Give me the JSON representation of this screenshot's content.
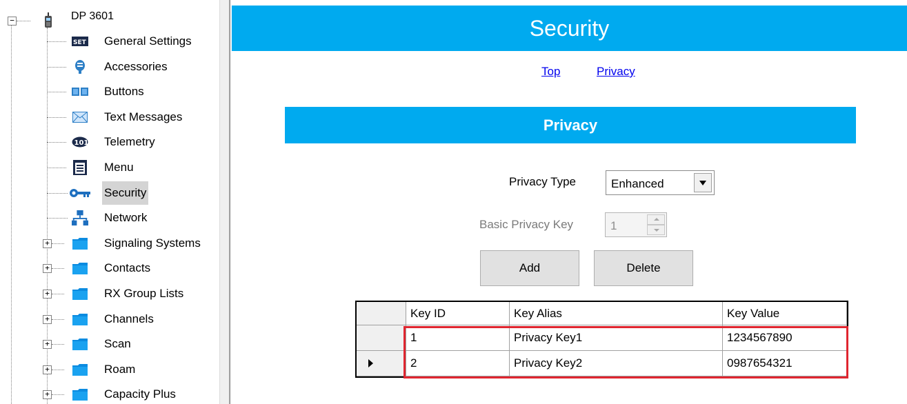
{
  "tree": {
    "root": {
      "label": "DP 3601",
      "icon": "radio-device-icon",
      "expander": "−"
    },
    "items": [
      {
        "label": "General Settings",
        "icon": "settings-icon"
      },
      {
        "label": "Accessories",
        "icon": "accessory-icon"
      },
      {
        "label": "Buttons",
        "icon": "buttons-icon"
      },
      {
        "label": "Text Messages",
        "icon": "envelope-icon"
      },
      {
        "label": "Telemetry",
        "icon": "telemetry-icon"
      },
      {
        "label": "Menu",
        "icon": "menu-icon"
      },
      {
        "label": "Security",
        "icon": "key-icon",
        "selected": true
      },
      {
        "label": "Network",
        "icon": "network-icon"
      },
      {
        "label": "Signaling Systems",
        "icon": "folder-icon",
        "expander": "+"
      },
      {
        "label": "Contacts",
        "icon": "folder-icon",
        "expander": "+"
      },
      {
        "label": "RX Group Lists",
        "icon": "folder-icon",
        "expander": "+"
      },
      {
        "label": "Channels",
        "icon": "folder-icon",
        "expander": "+"
      },
      {
        "label": "Scan",
        "icon": "folder-icon",
        "expander": "+"
      },
      {
        "label": "Roam",
        "icon": "folder-icon",
        "expander": "+"
      },
      {
        "label": "Capacity Plus",
        "icon": "folder-icon",
        "expander": "+"
      }
    ],
    "settings_icon_text": "SET"
  },
  "header": {
    "title": "Security"
  },
  "nav": {
    "links": [
      "Top",
      "Privacy"
    ]
  },
  "section": {
    "title": "Privacy"
  },
  "form": {
    "privacy_type_label": "Privacy Type",
    "privacy_type_value": "Enhanced",
    "basic_key_label": "Basic Privacy Key",
    "basic_key_value": "1",
    "add_label": "Add",
    "delete_label": "Delete"
  },
  "grid": {
    "columns": [
      "Key ID",
      "Key Alias",
      "Key Value"
    ],
    "rows": [
      {
        "id": "1",
        "alias": "Privacy Key1",
        "value": "1234567890",
        "current": false
      },
      {
        "id": "2",
        "alias": "Privacy Key2",
        "value": "0987654321",
        "current": true
      }
    ]
  },
  "colors": {
    "accent": "#00aaef",
    "highlight": "#e0252f",
    "selected": "#d4d4d4"
  }
}
